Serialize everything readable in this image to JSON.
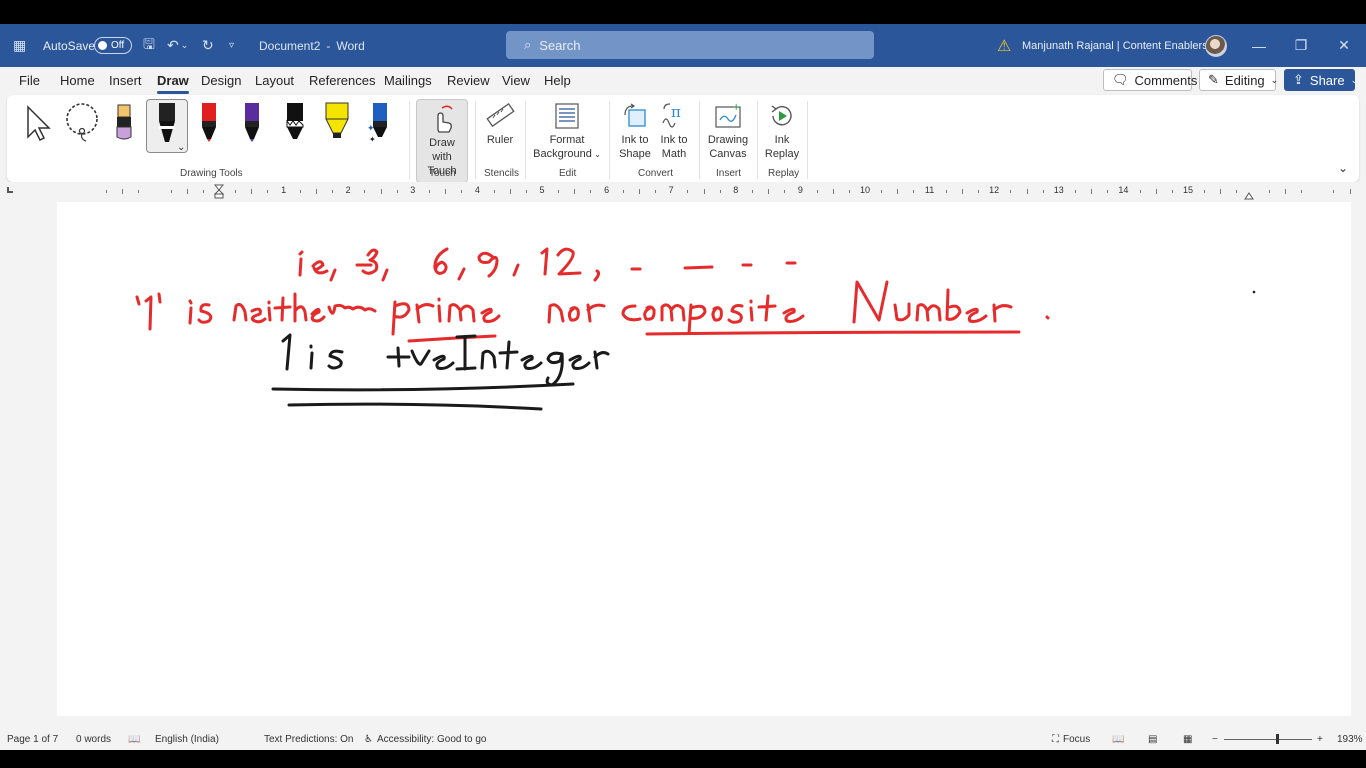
{
  "titlebar": {
    "autosave_label": "AutoSave",
    "autosave_state": "Off",
    "doc_title": "Document2",
    "separator": "-",
    "app_name": "Word",
    "search_placeholder": "Search",
    "user": "Manjunath Rajanal | Content Enablers"
  },
  "menu": {
    "tabs": [
      "File",
      "Home",
      "Insert",
      "Draw",
      "Design",
      "Layout",
      "References",
      "Mailings",
      "Review",
      "View",
      "Help"
    ],
    "active": "Draw",
    "comments": "Comments",
    "editing": "Editing",
    "share": "Share"
  },
  "ribbon": {
    "groups": {
      "drawing_tools": "Drawing Tools",
      "touch": "Touch",
      "stencils": "Stencils",
      "edit": "Edit",
      "convert": "Convert",
      "insert": "Insert",
      "replay": "Replay"
    },
    "buttons": {
      "draw_with_touch": [
        "Draw with",
        "Touch"
      ],
      "ruler": "Ruler",
      "format_background": [
        "Format",
        "Background"
      ],
      "ink_to_shape": [
        "Ink to",
        "Shape"
      ],
      "ink_to_math": [
        "Ink to",
        "Math"
      ],
      "drawing_canvas": [
        "Drawing",
        "Canvas"
      ],
      "ink_replay": [
        "Ink",
        "Replay"
      ]
    },
    "pen_colors": [
      "#e02020",
      "#5b2c9e",
      "#111111",
      "#f5e400",
      "#1f5fbf"
    ]
  },
  "ruler": {
    "numbers": [
      "1",
      "2",
      "3",
      "4",
      "5",
      "6",
      "7",
      "8",
      "9",
      "10",
      "11",
      "12",
      "13",
      "14",
      "15"
    ]
  },
  "ink": {
    "line1": "ie, 3, 6, 9, 12, - - - -",
    "line2": "'1' is neither prime nor composite Number.",
    "line3": "1 is +ve Integer",
    "red": "#e52b2b",
    "black": "#1a1a1a"
  },
  "status": {
    "page": "Page 1 of 7",
    "words": "0 words",
    "language": "English (India)",
    "predictions": "Text Predictions: On",
    "accessibility": "Accessibility: Good to go",
    "focus": "Focus",
    "zoom": "193%"
  }
}
